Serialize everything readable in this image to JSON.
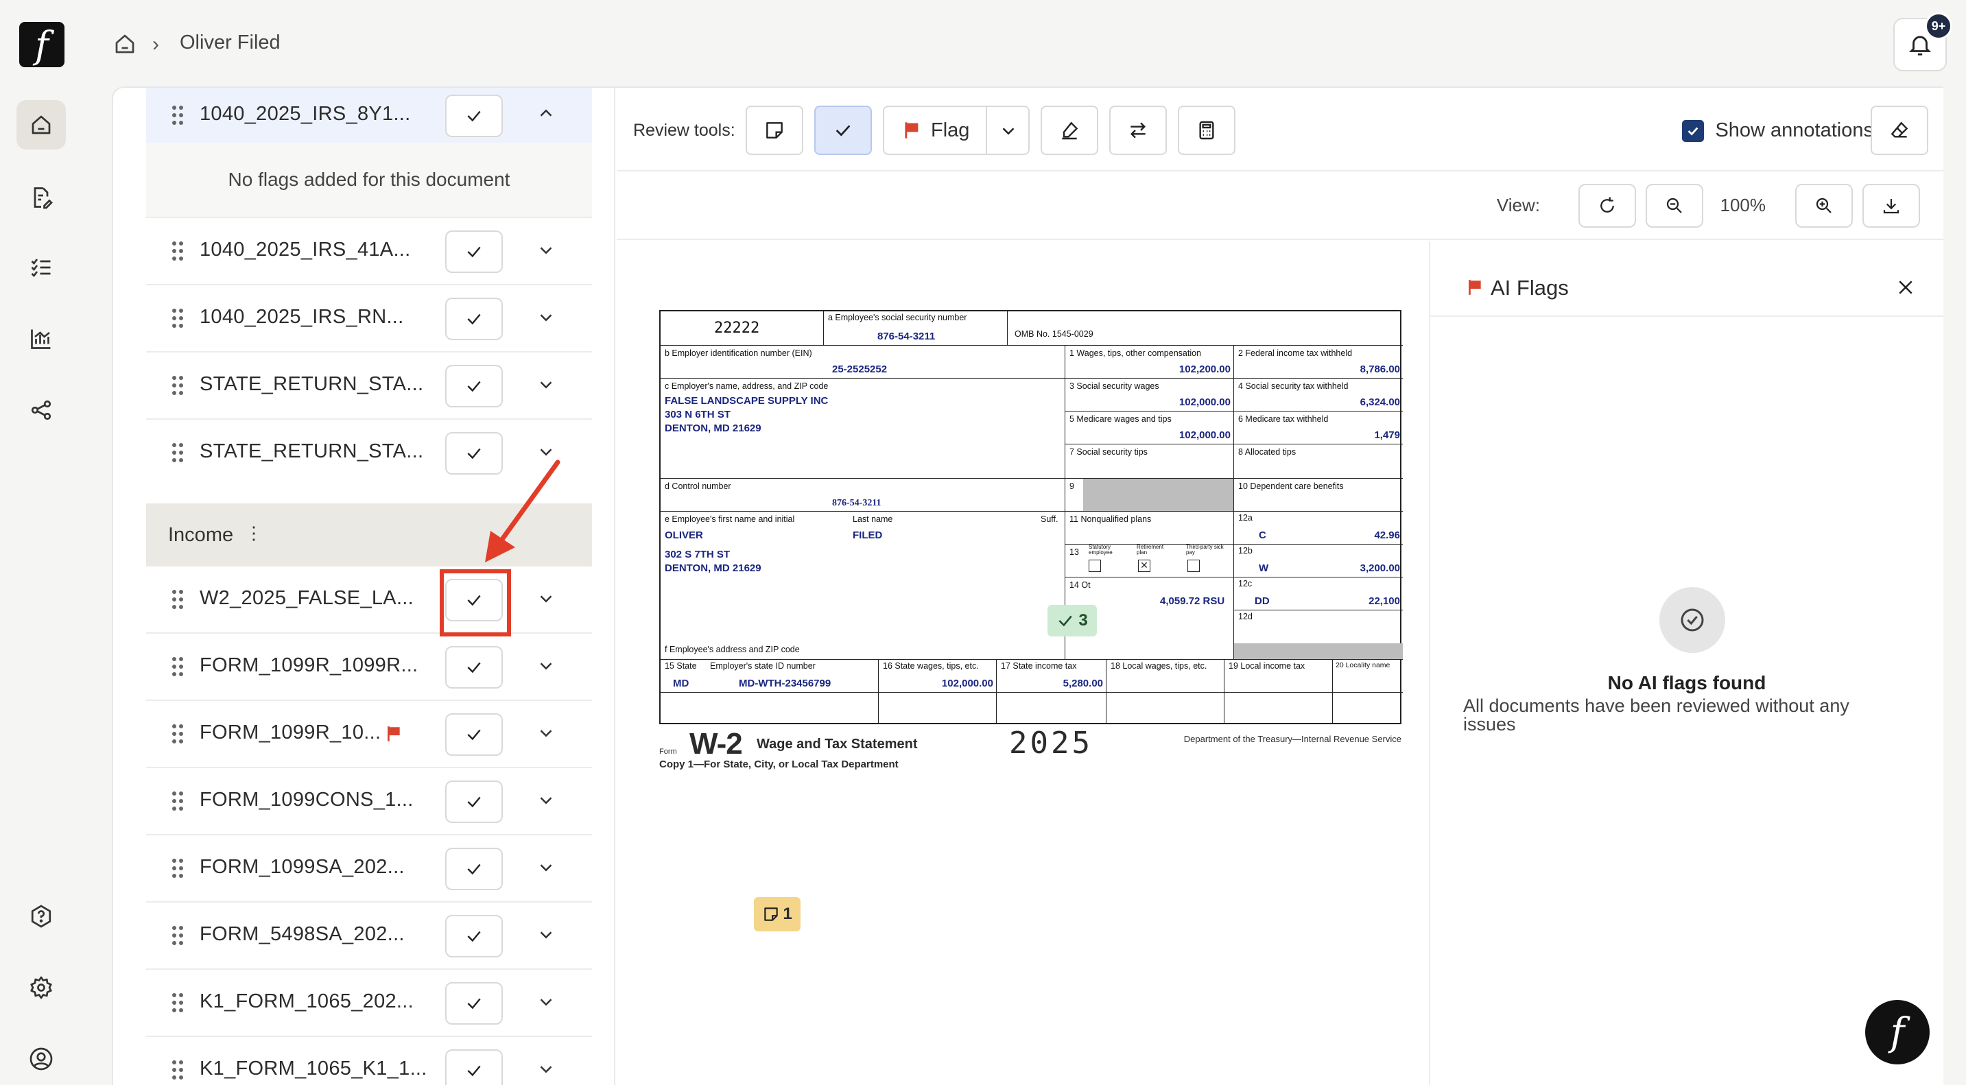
{
  "app": {
    "logo_glyph": "f"
  },
  "breadcrumb": {
    "current": "Oliver Filed",
    "separator": "›"
  },
  "notifications": {
    "badge": "9+"
  },
  "rail": [
    "home-icon",
    "file-pen-icon",
    "checklist-icon",
    "chart-icon",
    "share-icon",
    "help-icon",
    "gear-icon",
    "user-circle-icon"
  ],
  "documents": {
    "top": [
      {
        "name": "1040_2025_IRS_8Y1..."
      },
      {
        "name": "1040_2025_IRS_41A..."
      },
      {
        "name": "1040_2025_IRS_RN..."
      },
      {
        "name": "STATE_RETURN_STA..."
      },
      {
        "name": "STATE_RETURN_STA..."
      }
    ],
    "no_flags_text": "No flags added for this document",
    "section_income": "Income",
    "section_kebab": "⋮",
    "income": [
      {
        "name": "W2_2025_FALSE_LA..."
      },
      {
        "name": "FORM_1099R_1099R..."
      },
      {
        "name": "FORM_1099R_10..."
      },
      {
        "name": "FORM_1099CONS_1..."
      },
      {
        "name": "FORM_1099SA_202..."
      },
      {
        "name": "FORM_5498SA_202..."
      },
      {
        "name": "K1_FORM_1065_202..."
      },
      {
        "name": "K1_FORM_1065_K1_1..."
      }
    ]
  },
  "toolbar": {
    "review_label": "Review tools:",
    "flag_label": "Flag",
    "show_annotations": "Show annotations"
  },
  "viewbar": {
    "label": "View:",
    "zoom": "100%"
  },
  "w2": {
    "box_a_code": "22222",
    "a_label": "a  Employee's social security number",
    "ssn": "876-54-3211",
    "omb": "OMB No. 1545-0029",
    "b_label": "b  Employer identification number (EIN)",
    "ein": "25-2525252",
    "c_label": "c  Employer's name, address, and ZIP code",
    "employer_name": "FALSE LANDSCAPE SUPPLY INC",
    "employer_addr1": "303 N 6TH ST",
    "employer_addr2": "DENTON, MD 21629",
    "d_label": "d  Control number",
    "control_number": "876-54-3211",
    "e_label": "e  Employee's first name and initial",
    "last_label": "Last name",
    "suff_label": "Suff.",
    "first_name": "OLIVER",
    "last_name": "FILED",
    "emp_addr1": "302 S 7TH ST",
    "emp_addr2": "DENTON, MD 21629",
    "f_label": "f  Employee's address and ZIP code",
    "box1_label": "1   Wages, tips, other compensation",
    "box1": "102,200.00",
    "box2_label": "2   Federal income tax withheld",
    "box2": "8,786.00",
    "box3_label": "3   Social security wages",
    "box3": "102,000.00",
    "box4_label": "4   Social security tax withheld",
    "box4": "6,324.00",
    "box5_label": "5   Medicare wages and tips",
    "box5": "102,000.00",
    "box6_label": "6   Medicare tax withheld",
    "box6": "1,479",
    "box7_label": "7   Social security tips",
    "box8_label": "8   Allocated tips",
    "box9_label": "9",
    "box10_label": "10   Dependent care benefits",
    "box11_label": "11   Nonqualified plans",
    "box12a_label": "12a",
    "box12a_code": "C",
    "box12a": "42.96",
    "box12b_label": "12b",
    "box12b_code": "W",
    "box12b": "3,200.00",
    "box12c_label": "12c",
    "box12c_code": "DD",
    "box12c": "22,100",
    "box12d_label": "12d",
    "box13_label": "13",
    "box13_stat": "Statutory employee",
    "box13_ret": "Retirement plan",
    "box13_third": "Third-party sick pay",
    "box14_label": "14  Ot",
    "box14": "4,059.72 RSU",
    "box15_label": "15  State",
    "box15_id_label": "Employer's state ID number",
    "state": "MD",
    "state_id": "MD-WTH-23456799",
    "box16_label": "16  State wages, tips, etc.",
    "box16": "102,000.00",
    "box17_label": "17  State income tax",
    "box17": "5,280.00",
    "box18_label": "18  Local wages, tips, etc.",
    "box19_label": "19  Local income tax",
    "box20_label": "20  Locality name",
    "form_prefix": "Form",
    "form_name": "W-2",
    "form_title": "Wage and Tax Statement",
    "year": "2025",
    "dept": "Department of the Treasury—Internal Revenue Service",
    "copy_line": "Copy 1—For State, City, or Local Tax Department"
  },
  "annotations": {
    "green_count": "3",
    "yellow_count": "1"
  },
  "ai_flags": {
    "title": "AI Flags",
    "empty_title": "No AI flags found",
    "empty_sub": "All documents have been reviewed without any issues"
  },
  "colors": {
    "accent": "#1d3b75",
    "highlight": "#e23d28",
    "flag": "#d9442e",
    "active_tool": "#dfe7fb"
  }
}
